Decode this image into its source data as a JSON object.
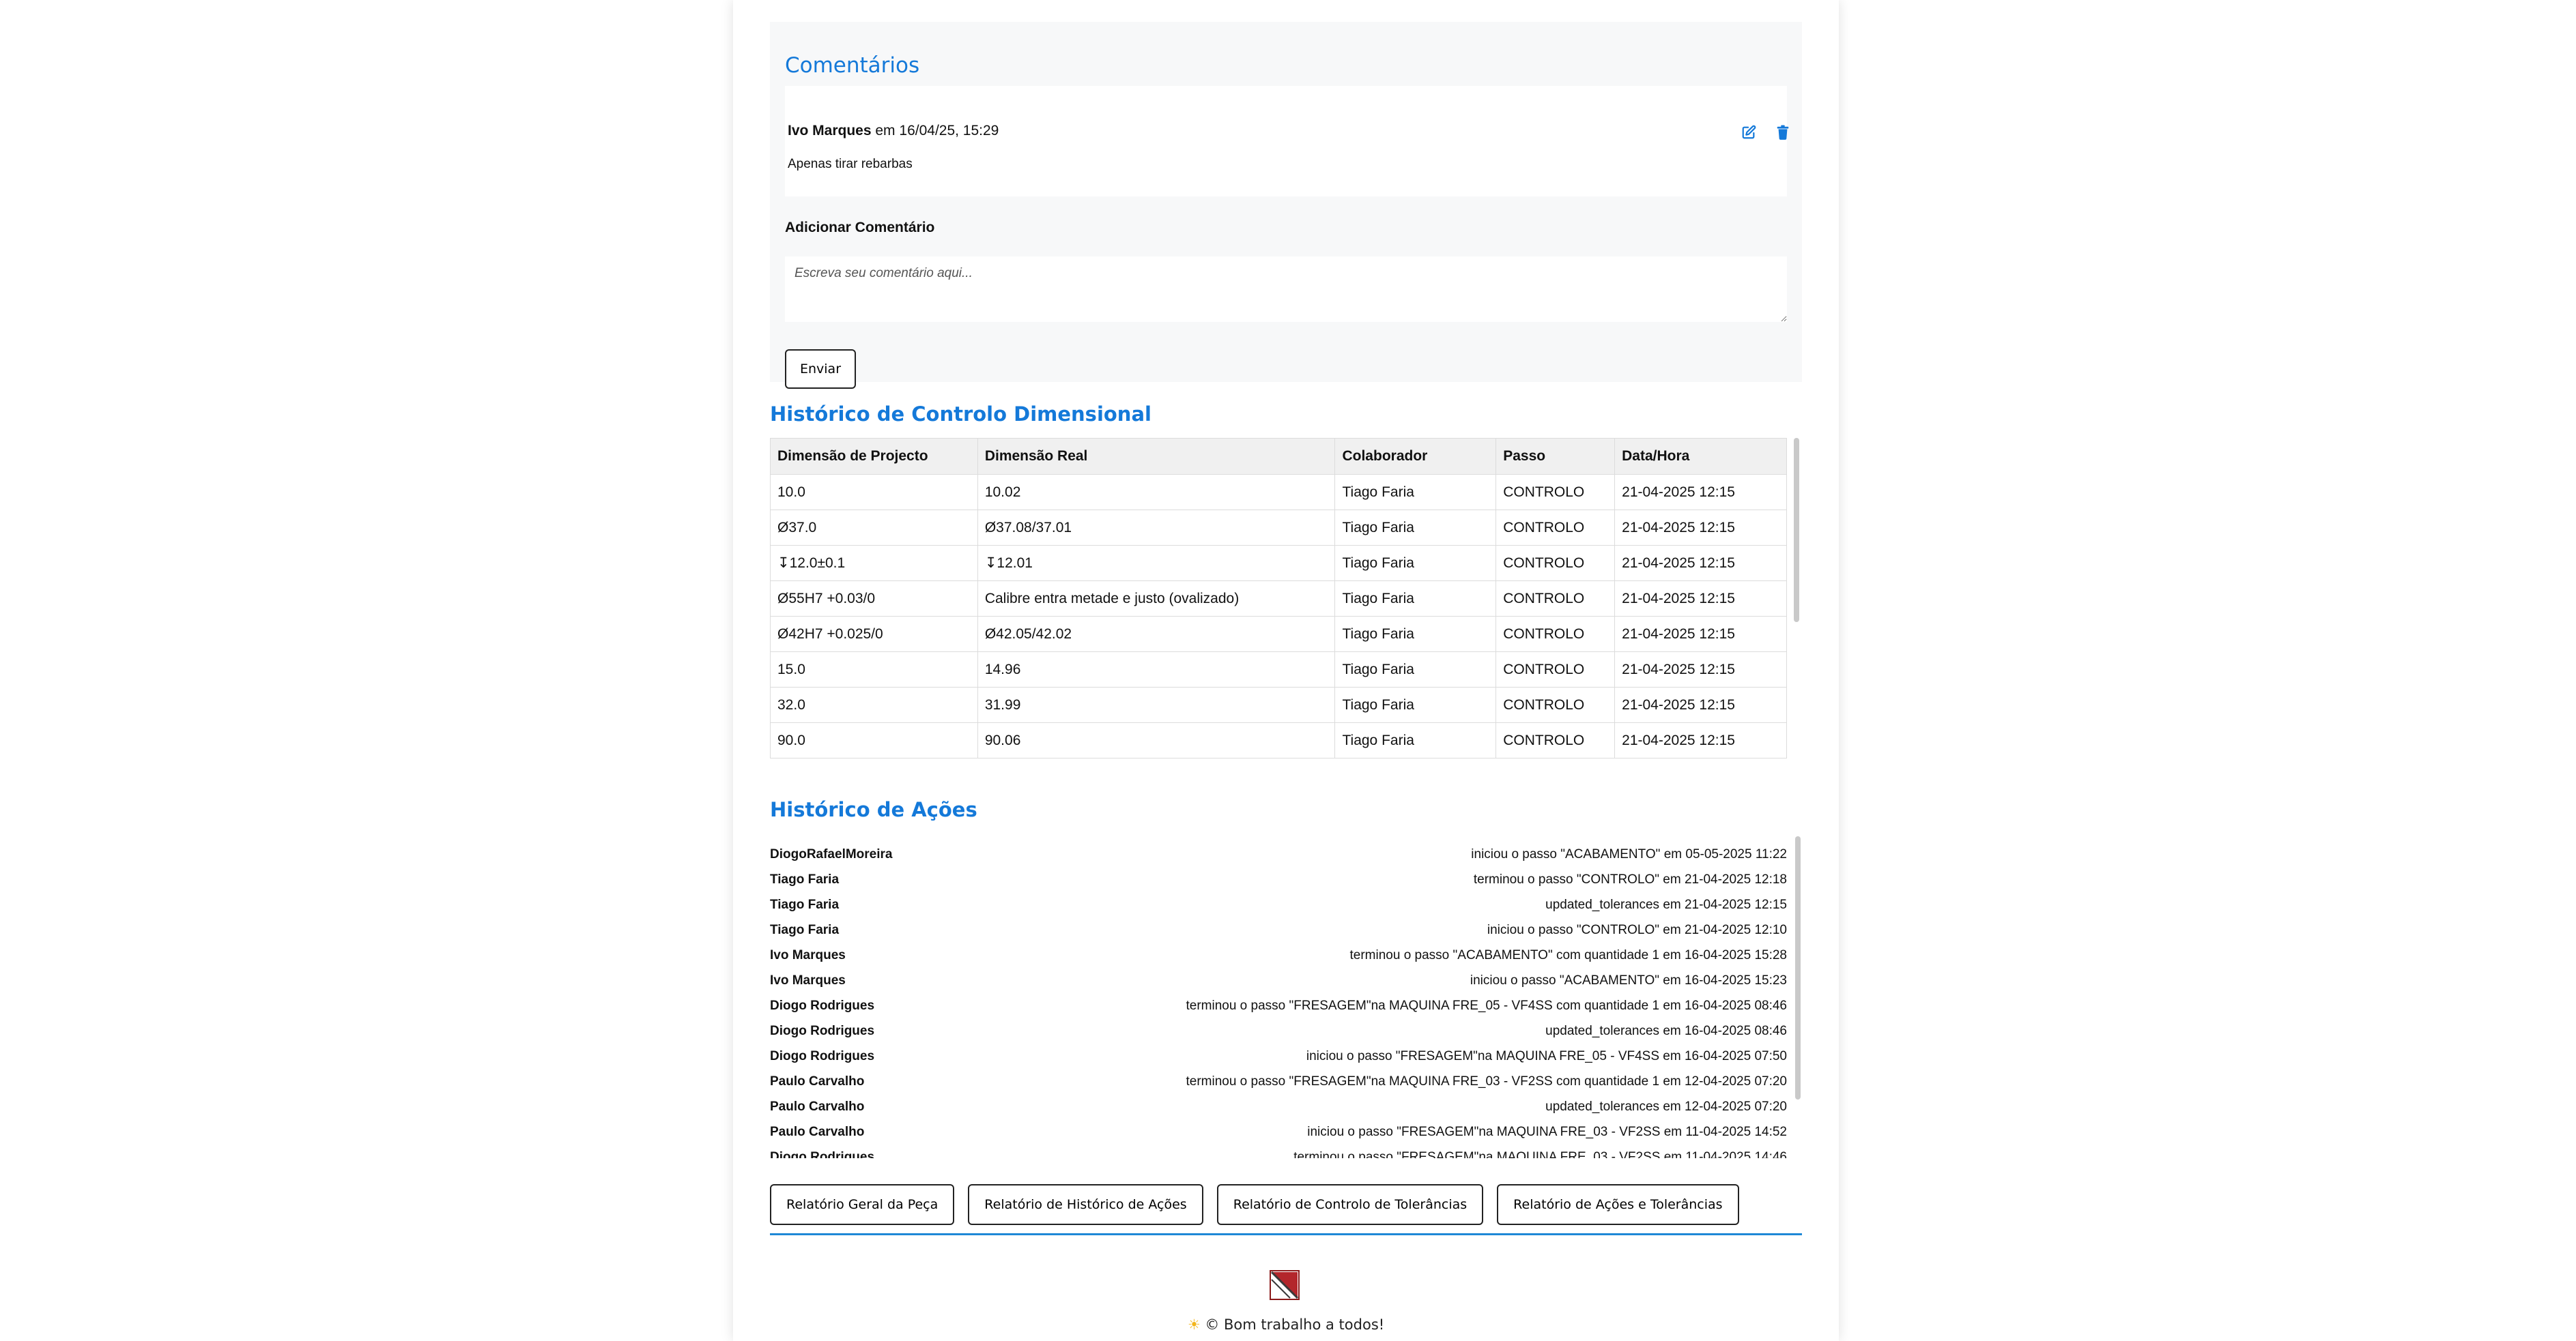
{
  "comments": {
    "title": "Comentários",
    "items": [
      {
        "author": "Ivo Marques",
        "meta": " em 16/04/25, 15:29",
        "text": "Apenas tirar rebarbas"
      }
    ],
    "add_label": "Adicionar Comentário",
    "placeholder": "Escreva seu comentário aqui...",
    "send_label": "Enviar",
    "icons": {
      "edit": "edit-icon",
      "delete": "trash-icon"
    },
    "icon_color": "#1479d9"
  },
  "dimensional": {
    "title": "Histórico de Controlo Dimensional",
    "columns": [
      "Dimensão de Projecto",
      "Dimensão Real",
      "Colaborador",
      "Passo",
      "Data/Hora"
    ],
    "rows": [
      [
        "10.0",
        "10.02",
        "Tiago Faria",
        "CONTROLO",
        "21-04-2025 12:15"
      ],
      [
        "Ø37.0",
        "Ø37.08/37.01",
        "Tiago Faria",
        "CONTROLO",
        "21-04-2025 12:15"
      ],
      [
        "↧12.0±0.1",
        "↧12.01",
        "Tiago Faria",
        "CONTROLO",
        "21-04-2025 12:15"
      ],
      [
        "Ø55H7 +0.03/0",
        "Calibre entra metade e justo (ovalizado)",
        "Tiago Faria",
        "CONTROLO",
        "21-04-2025 12:15"
      ],
      [
        "Ø42H7 +0.025/0",
        "Ø42.05/42.02",
        "Tiago Faria",
        "CONTROLO",
        "21-04-2025 12:15"
      ],
      [
        "15.0",
        "14.96",
        "Tiago Faria",
        "CONTROLO",
        "21-04-2025 12:15"
      ],
      [
        "32.0",
        "31.99",
        "Tiago Faria",
        "CONTROLO",
        "21-04-2025 12:15"
      ],
      [
        "90.0",
        "90.06",
        "Tiago Faria",
        "CONTROLO",
        "21-04-2025 12:15"
      ]
    ]
  },
  "actions": {
    "title": "Histórico de Ações",
    "items": [
      {
        "user": "DiogoRafaelMoreira",
        "desc": "iniciou o passo \"ACABAMENTO\" em 05-05-2025 11:22"
      },
      {
        "user": "Tiago Faria",
        "desc": "terminou o passo \"CONTROLO\" em 21-04-2025 12:18"
      },
      {
        "user": "Tiago Faria",
        "desc": "updated_tolerances em 21-04-2025 12:15"
      },
      {
        "user": "Tiago Faria",
        "desc": "iniciou o passo \"CONTROLO\" em 21-04-2025 12:10"
      },
      {
        "user": "Ivo Marques",
        "desc": "terminou o passo \"ACABAMENTO\" com quantidade 1 em 16-04-2025 15:28"
      },
      {
        "user": "Ivo Marques",
        "desc": "iniciou o passo \"ACABAMENTO\" em 16-04-2025 15:23"
      },
      {
        "user": "Diogo Rodrigues",
        "desc": "terminou o passo \"FRESAGEM\"na MAQUINA FRE_05 - VF4SS com quantidade 1 em 16-04-2025 08:46"
      },
      {
        "user": "Diogo Rodrigues",
        "desc": "updated_tolerances em 16-04-2025 08:46"
      },
      {
        "user": "Diogo Rodrigues",
        "desc": "iniciou o passo \"FRESAGEM\"na MAQUINA FRE_05 - VF4SS em 16-04-2025 07:50"
      },
      {
        "user": "Paulo Carvalho",
        "desc": "terminou o passo \"FRESAGEM\"na MAQUINA FRE_03 - VF2SS com quantidade 1 em 12-04-2025 07:20"
      },
      {
        "user": "Paulo Carvalho",
        "desc": "updated_tolerances em 12-04-2025 07:20"
      },
      {
        "user": "Paulo Carvalho",
        "desc": "iniciou o passo \"FRESAGEM\"na MAQUINA FRE_03 - VF2SS em 11-04-2025 14:52"
      },
      {
        "user": "Diogo Rodrigues",
        "desc": "terminou o passo \"FRESAGEM\"na MAQUINA FRE_03 - VF2SS em 11-04-2025 14:46"
      }
    ]
  },
  "reports": {
    "buttons": [
      "Relatório Geral da Peça",
      "Relatório de Histórico de Ações",
      "Relatório de Controlo de Tolerâncias",
      "Relatório de Ações e Tolerâncias"
    ]
  },
  "footer": {
    "logo_icon": "company-logo-icon",
    "sun_icon": "sun-icon",
    "text": "© Bom trabalho a todos!",
    "accent": "#1f88d6"
  }
}
